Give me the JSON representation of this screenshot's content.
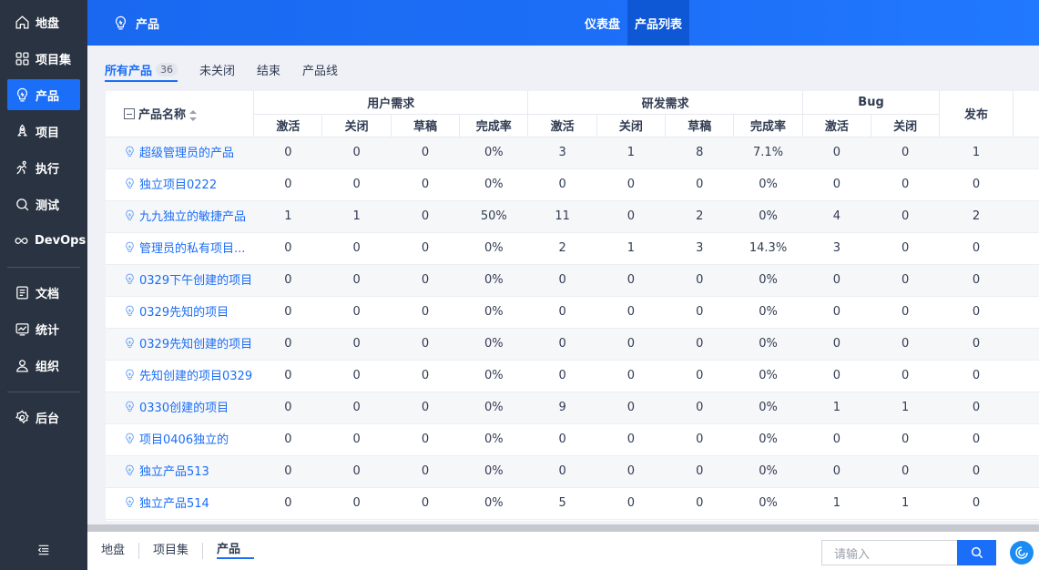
{
  "sidebar": {
    "items": [
      {
        "label": "地盘",
        "icon": "home-icon"
      },
      {
        "label": "项目集",
        "icon": "grid-icon"
      },
      {
        "label": "产品",
        "icon": "bulb-icon"
      },
      {
        "label": "项目",
        "icon": "rocket-icon"
      },
      {
        "label": "执行",
        "icon": "run-icon"
      },
      {
        "label": "测试",
        "icon": "search-icon"
      },
      {
        "label": "DevOps",
        "icon": "infinity-icon"
      },
      {
        "label": "文档",
        "icon": "doc-icon"
      },
      {
        "label": "统计",
        "icon": "chart-icon"
      },
      {
        "label": "组织",
        "icon": "user-icon"
      },
      {
        "label": "后台",
        "icon": "gear-icon"
      }
    ],
    "active_index": 2
  },
  "header": {
    "title": "产品",
    "tabs": [
      "仪表盘",
      "产品列表"
    ],
    "active_tab": 1
  },
  "subtabs": {
    "items": [
      "所有产品",
      "未关闭",
      "结束",
      "产品线"
    ],
    "all_count": "36"
  },
  "table": {
    "name_header": "产品名称",
    "group_headers": [
      "用户需求",
      "研发需求",
      "Bug",
      "发布"
    ],
    "sub_headers": [
      "激活",
      "关闭",
      "草稿",
      "完成率",
      "激活",
      "关闭",
      "草稿",
      "完成率",
      "激活",
      "关闭"
    ],
    "rows": [
      {
        "name": "超级管理员的产品",
        "cells": [
          "0",
          "0",
          "0",
          "0%",
          "3",
          "1",
          "8",
          "7.1%",
          "0",
          "0",
          "1"
        ]
      },
      {
        "name": "独立项目0222",
        "cells": [
          "0",
          "0",
          "0",
          "0%",
          "0",
          "0",
          "0",
          "0%",
          "0",
          "0",
          "0"
        ]
      },
      {
        "name": "九九独立的敏捷产品",
        "cells": [
          "1",
          "1",
          "0",
          "50%",
          "11",
          "0",
          "2",
          "0%",
          "4",
          "0",
          "2"
        ]
      },
      {
        "name": "管理员的私有项目...",
        "cells": [
          "0",
          "0",
          "0",
          "0%",
          "2",
          "1",
          "3",
          "14.3%",
          "3",
          "0",
          "0"
        ]
      },
      {
        "name": "0329下午创建的项目",
        "cells": [
          "0",
          "0",
          "0",
          "0%",
          "0",
          "0",
          "0",
          "0%",
          "0",
          "0",
          "0"
        ]
      },
      {
        "name": "0329先知的项目",
        "cells": [
          "0",
          "0",
          "0",
          "0%",
          "0",
          "0",
          "0",
          "0%",
          "0",
          "0",
          "0"
        ]
      },
      {
        "name": "0329先知创建的项目",
        "cells": [
          "0",
          "0",
          "0",
          "0%",
          "0",
          "0",
          "0",
          "0%",
          "0",
          "0",
          "0"
        ]
      },
      {
        "name": "先知创建的项目0329",
        "cells": [
          "0",
          "0",
          "0",
          "0%",
          "0",
          "0",
          "0",
          "0%",
          "0",
          "0",
          "0"
        ]
      },
      {
        "name": "0330创建的项目",
        "cells": [
          "0",
          "0",
          "0",
          "0%",
          "9",
          "0",
          "0",
          "0%",
          "1",
          "1",
          "0"
        ]
      },
      {
        "name": "项目0406独立的",
        "cells": [
          "0",
          "0",
          "0",
          "0%",
          "0",
          "0",
          "0",
          "0%",
          "0",
          "0",
          "0"
        ]
      },
      {
        "name": "独立产品513",
        "cells": [
          "0",
          "0",
          "0",
          "0%",
          "0",
          "0",
          "0",
          "0%",
          "0",
          "0",
          "0"
        ]
      },
      {
        "name": "独立产品514",
        "cells": [
          "0",
          "0",
          "0",
          "0%",
          "5",
          "0",
          "0",
          "0%",
          "1",
          "1",
          "0"
        ]
      }
    ]
  },
  "footer": {
    "breadcrumbs": [
      "地盘",
      "项目集",
      "产品"
    ],
    "search_placeholder": "请输入"
  },
  "colors": {
    "primary": "#1b6ef7",
    "sidebar_bg": "#2a3341",
    "link": "#1b6ef7"
  }
}
